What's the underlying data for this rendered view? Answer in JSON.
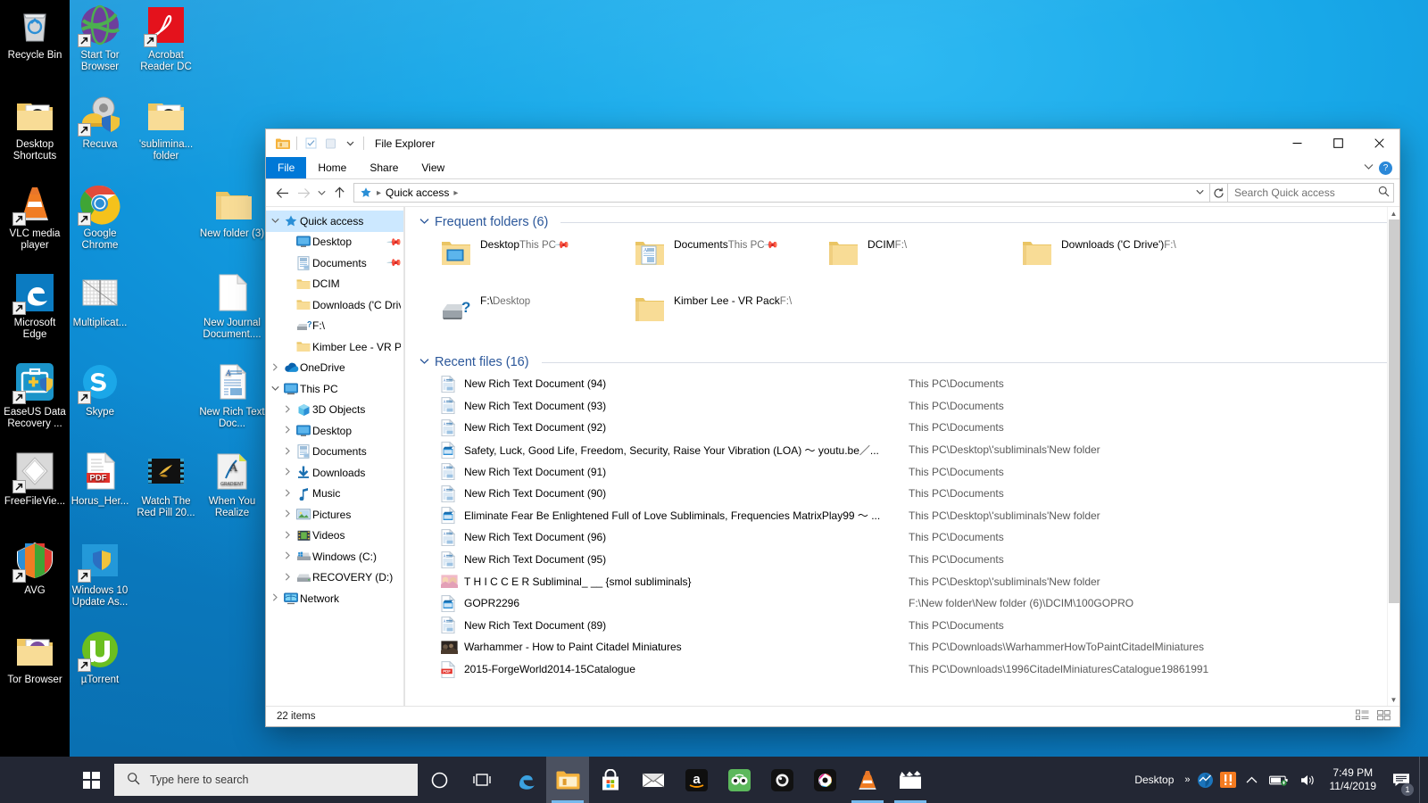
{
  "desktop": {
    "icons": [
      {
        "label": "Recycle Bin",
        "icon": "recycle-bin-icon",
        "col": 0,
        "row": 0,
        "shortcut": false
      },
      {
        "label": "Desktop Shortcuts",
        "icon": "folder-media-icon",
        "col": 0,
        "row": 1,
        "shortcut": false
      },
      {
        "label": "VLC media player",
        "icon": "vlc-cone-icon",
        "col": 0,
        "row": 2,
        "shortcut": true
      },
      {
        "label": "Microsoft Edge",
        "icon": "edge-icon",
        "col": 0,
        "row": 3,
        "shortcut": true
      },
      {
        "label": "EaseUS Data Recovery ...",
        "icon": "easeus-icon",
        "col": 0,
        "row": 4,
        "shortcut": true
      },
      {
        "label": "FreeFileVie...",
        "icon": "freefileviewer-icon",
        "col": 0,
        "row": 5,
        "shortcut": true
      },
      {
        "label": "AVG",
        "icon": "avg-icon",
        "col": 0,
        "row": 6,
        "shortcut": true
      },
      {
        "label": "Tor Browser",
        "icon": "folder-tor-icon",
        "col": 0,
        "row": 7,
        "shortcut": false
      },
      {
        "label": "Start Tor Browser",
        "icon": "tor-globe-icon",
        "col": 1,
        "row": 0,
        "shortcut": true
      },
      {
        "label": "Recuva",
        "icon": "recuva-icon",
        "col": 1,
        "row": 1,
        "shortcut": true
      },
      {
        "label": "Google Chrome",
        "icon": "chrome-icon",
        "col": 1,
        "row": 2,
        "shortcut": true
      },
      {
        "label": "Multiplicat...",
        "icon": "image-grid-icon",
        "col": 1,
        "row": 3,
        "shortcut": false
      },
      {
        "label": "Skype",
        "icon": "skype-icon",
        "col": 1,
        "row": 4,
        "shortcut": true
      },
      {
        "label": "Horus_Her...",
        "icon": "pdf-file-icon",
        "col": 1,
        "row": 5,
        "shortcut": false
      },
      {
        "label": "Windows 10 Update As...",
        "icon": "windows-update-icon",
        "col": 1,
        "row": 6,
        "shortcut": true
      },
      {
        "label": "µTorrent",
        "icon": "utorrent-icon",
        "col": 1,
        "row": 7,
        "shortcut": true
      },
      {
        "label": "Acrobat Reader DC",
        "icon": "acrobat-icon",
        "col": 2,
        "row": 0,
        "shortcut": true
      },
      {
        "label": "'sublimina... folder",
        "icon": "folder-media-icon",
        "col": 2,
        "row": 1,
        "shortcut": false
      },
      {
        "label": "Watch The Red Pill 20...",
        "icon": "video-film-icon",
        "col": 2,
        "row": 5,
        "shortcut": false
      },
      {
        "label": "New folder (3)",
        "icon": "folder-icon",
        "col": 3,
        "row": 2,
        "shortcut": false
      },
      {
        "label": "New Journal Document....",
        "icon": "journal-doc-icon",
        "col": 3,
        "row": 3,
        "shortcut": false
      },
      {
        "label": "New Rich Text Doc...",
        "icon": "rtf-doc-icon",
        "col": 3,
        "row": 4,
        "shortcut": false
      },
      {
        "label": "When You Realize",
        "icon": "gradient-image-icon",
        "col": 3,
        "row": 5,
        "shortcut": false
      }
    ]
  },
  "explorer": {
    "title": "File Explorer",
    "quick_access_toolbar": [
      {
        "name": "explorer-folder-icon",
        "label": "File Explorer"
      },
      {
        "name": "properties-icon",
        "label": "Properties"
      },
      {
        "name": "new-folder-icon",
        "label": "New folder"
      },
      {
        "name": "customize-qat-icon",
        "label": "Customize Quick Access Toolbar"
      }
    ],
    "window_controls": {
      "minimize": "—",
      "maximize": "☐",
      "close": "✕"
    },
    "ribbon_tabs": [
      {
        "label": "File",
        "active": true
      },
      {
        "label": "Home",
        "active": false
      },
      {
        "label": "Share",
        "active": false
      },
      {
        "label": "View",
        "active": false
      }
    ],
    "ribbon_right": {
      "collapse": "chevron-down-icon",
      "help": "?"
    },
    "address": {
      "back": "back-arrow-icon",
      "forward": "forward-arrow-icon",
      "recent": "chevron-down-icon",
      "up": "up-arrow-icon",
      "crumbs": [
        "Quick access"
      ],
      "dropdown": "chevron-down-icon",
      "refresh": "refresh-icon"
    },
    "search": {
      "placeholder": "Search Quick access",
      "value": ""
    },
    "navpane": [
      {
        "label": "Quick access",
        "level": 0,
        "chevron": "expanded",
        "icon": "star-pin-icon",
        "selected": true,
        "pinned": false
      },
      {
        "label": "Desktop",
        "level": 1,
        "chevron": "none",
        "icon": "desktop-icon",
        "selected": false,
        "pinned": true
      },
      {
        "label": "Documents",
        "level": 1,
        "chevron": "none",
        "icon": "documents-icon",
        "selected": false,
        "pinned": true
      },
      {
        "label": "DCIM",
        "level": 1,
        "chevron": "none",
        "icon": "folder-icon",
        "selected": false,
        "pinned": false
      },
      {
        "label": "Downloads ('C Drive",
        "level": 1,
        "chevron": "none",
        "icon": "folder-icon",
        "selected": false,
        "pinned": false
      },
      {
        "label": "F:\\",
        "level": 1,
        "chevron": "none",
        "icon": "unknown-drive-icon",
        "selected": false,
        "pinned": false
      },
      {
        "label": "Kimber Lee - VR Pack",
        "level": 1,
        "chevron": "none",
        "icon": "folder-icon",
        "selected": false,
        "pinned": false
      },
      {
        "label": "OneDrive",
        "level": 0,
        "chevron": "collapsed",
        "icon": "onedrive-cloud-icon",
        "selected": false,
        "pinned": false
      },
      {
        "label": "This PC",
        "level": 0,
        "chevron": "expanded",
        "icon": "this-pc-icon",
        "selected": false,
        "pinned": false
      },
      {
        "label": "3D Objects",
        "level": 1,
        "chevron": "collapsed",
        "icon": "3d-objects-icon",
        "selected": false,
        "pinned": false
      },
      {
        "label": "Desktop",
        "level": 1,
        "chevron": "collapsed",
        "icon": "desktop-icon",
        "selected": false,
        "pinned": false
      },
      {
        "label": "Documents",
        "level": 1,
        "chevron": "collapsed",
        "icon": "documents-icon",
        "selected": false,
        "pinned": false
      },
      {
        "label": "Downloads",
        "level": 1,
        "chevron": "collapsed",
        "icon": "downloads-icon",
        "selected": false,
        "pinned": false
      },
      {
        "label": "Music",
        "level": 1,
        "chevron": "collapsed",
        "icon": "music-note-icon",
        "selected": false,
        "pinned": false
      },
      {
        "label": "Pictures",
        "level": 1,
        "chevron": "collapsed",
        "icon": "pictures-icon",
        "selected": false,
        "pinned": false
      },
      {
        "label": "Videos",
        "level": 1,
        "chevron": "collapsed",
        "icon": "videos-icon",
        "selected": false,
        "pinned": false
      },
      {
        "label": "Windows (C:)",
        "level": 1,
        "chevron": "collapsed",
        "icon": "windows-drive-icon",
        "selected": false,
        "pinned": false
      },
      {
        "label": "RECOVERY (D:)",
        "level": 1,
        "chevron": "collapsed",
        "icon": "drive-icon",
        "selected": false,
        "pinned": false
      },
      {
        "label": "Network",
        "level": 0,
        "chevron": "collapsed",
        "icon": "network-icon",
        "selected": false,
        "pinned": false
      }
    ],
    "frequent_folders": {
      "header": "Frequent folders (6)",
      "items": [
        {
          "name": "Desktop",
          "sub": "This PC",
          "icon": "folder-desktop-icon",
          "pinned": true
        },
        {
          "name": "Documents",
          "sub": "This PC",
          "icon": "folder-documents-icon",
          "pinned": true
        },
        {
          "name": "DCIM",
          "sub": "F:\\",
          "icon": "folder-icon",
          "pinned": false
        },
        {
          "name": "Downloads ('C Drive')",
          "sub": "F:\\",
          "icon": "folder-icon",
          "pinned": false
        },
        {
          "name": "F:\\",
          "sub": "Desktop",
          "icon": "unknown-drive-icon",
          "pinned": false
        },
        {
          "name": "Kimber Lee - VR Pack",
          "sub": "F:\\",
          "icon": "folder-icon",
          "pinned": false
        }
      ]
    },
    "recent_files": {
      "header": "Recent files (16)",
      "items": [
        {
          "name": "New Rich Text Document (94)",
          "path": "This PC\\Documents",
          "icon": "rtf-doc-icon"
        },
        {
          "name": "New Rich Text Document (93)",
          "path": "This PC\\Documents",
          "icon": "rtf-doc-icon"
        },
        {
          "name": "New Rich Text Document (92)",
          "path": "This PC\\Documents",
          "icon": "rtf-doc-icon"
        },
        {
          "name": "Safety, Luck, Good Life, Freedom, Security, Raise Your Vibration (LOA)  ～  youtu.be／...",
          "path": "This PC\\Desktop\\'subliminals'New folder",
          "icon": "video-file-icon"
        },
        {
          "name": "New Rich Text Document (91)",
          "path": "This PC\\Documents",
          "icon": "rtf-doc-icon"
        },
        {
          "name": "New Rich Text Document (90)",
          "path": "This PC\\Documents",
          "icon": "rtf-doc-icon"
        },
        {
          "name": "Eliminate Fear Be Enlightened Full of Love Subliminals, Frequencies MatrixPlay99  ～  ...",
          "path": "This PC\\Desktop\\'subliminals'New folder",
          "icon": "video-file-icon"
        },
        {
          "name": "New Rich Text Document (96)",
          "path": "This PC\\Documents",
          "icon": "rtf-doc-icon"
        },
        {
          "name": "New Rich Text Document (95)",
          "path": "This PC\\Documents",
          "icon": "rtf-doc-icon"
        },
        {
          "name": "T H I C C E R    Subliminal_ __ {smol subliminals}",
          "path": "This PC\\Desktop\\'subliminals'New folder",
          "icon": "thumbnail-pink-icon"
        },
        {
          "name": "GOPR2296",
          "path": "F:\\New folder\\New folder (6)\\DCIM\\100GOPRO",
          "icon": "video-file-icon"
        },
        {
          "name": "New Rich Text Document (89)",
          "path": "This PC\\Documents",
          "icon": "rtf-doc-icon"
        },
        {
          "name": "Warhammer -  How to Paint Citadel Miniatures",
          "path": "This PC\\Downloads\\WarhammerHowToPaintCitadelMiniatures",
          "icon": "thumbnail-dark-icon"
        },
        {
          "name": "2015-ForgeWorld2014-15Catalogue",
          "path": "This PC\\Downloads\\1996CitadelMiniaturesCatalogue19861991",
          "icon": "pdf-file-icon"
        }
      ]
    },
    "status": {
      "items_count": "22 items",
      "views": [
        "details-view-icon",
        "large-icons-view-icon"
      ]
    }
  },
  "taskbar": {
    "start": "windows-logo-icon",
    "search": {
      "placeholder": "Type here to search",
      "icon": "search-icon"
    },
    "cortana": "cortana-circle-icon",
    "task_view": "task-view-icon",
    "apps": [
      {
        "name": "edge-taskbar-icon",
        "label": "Microsoft Edge",
        "state": "idle"
      },
      {
        "name": "file-explorer-taskbar-icon",
        "label": "File Explorer",
        "state": "active"
      },
      {
        "name": "microsoft-store-taskbar-icon",
        "label": "Microsoft Store",
        "state": "idle"
      },
      {
        "name": "mail-taskbar-icon",
        "label": "Mail",
        "state": "idle"
      },
      {
        "name": "amazon-taskbar-icon",
        "label": "Amazon",
        "state": "idle"
      },
      {
        "name": "tripadvisor-taskbar-icon",
        "label": "TripAdvisor",
        "state": "idle"
      },
      {
        "name": "camera-taskbar-icon",
        "label": "Camera",
        "state": "idle"
      },
      {
        "name": "photo-editor-taskbar-icon",
        "label": "Photo Editor",
        "state": "idle"
      },
      {
        "name": "vlc-taskbar-icon",
        "label": "VLC media player",
        "state": "running"
      },
      {
        "name": "movies-tv-taskbar-icon",
        "label": "Movies & TV",
        "state": "running"
      }
    ],
    "tray": {
      "desktop_label": "Desktop",
      "overflow": "show-hidden-icons-chevron",
      "icons": [
        {
          "name": "defender-tray-icon",
          "label": "Windows Security"
        },
        {
          "name": "avg-tray-icon",
          "label": "AVG"
        },
        {
          "name": "hidden-icons-chevron",
          "label": "Show hidden icons"
        },
        {
          "name": "battery-tray-icon",
          "label": "Battery"
        },
        {
          "name": "volume-tray-icon",
          "label": "Speakers"
        }
      ],
      "time": "7:49 PM",
      "date": "11/4/2019",
      "action_center": {
        "icon": "action-center-icon",
        "badge": "1"
      }
    }
  },
  "colors": {
    "accent": "#0078d7",
    "taskbar": "#232734",
    "selection": "#cce8ff",
    "group_header": "#2b579a",
    "wallpaper": "#18a8e8"
  }
}
